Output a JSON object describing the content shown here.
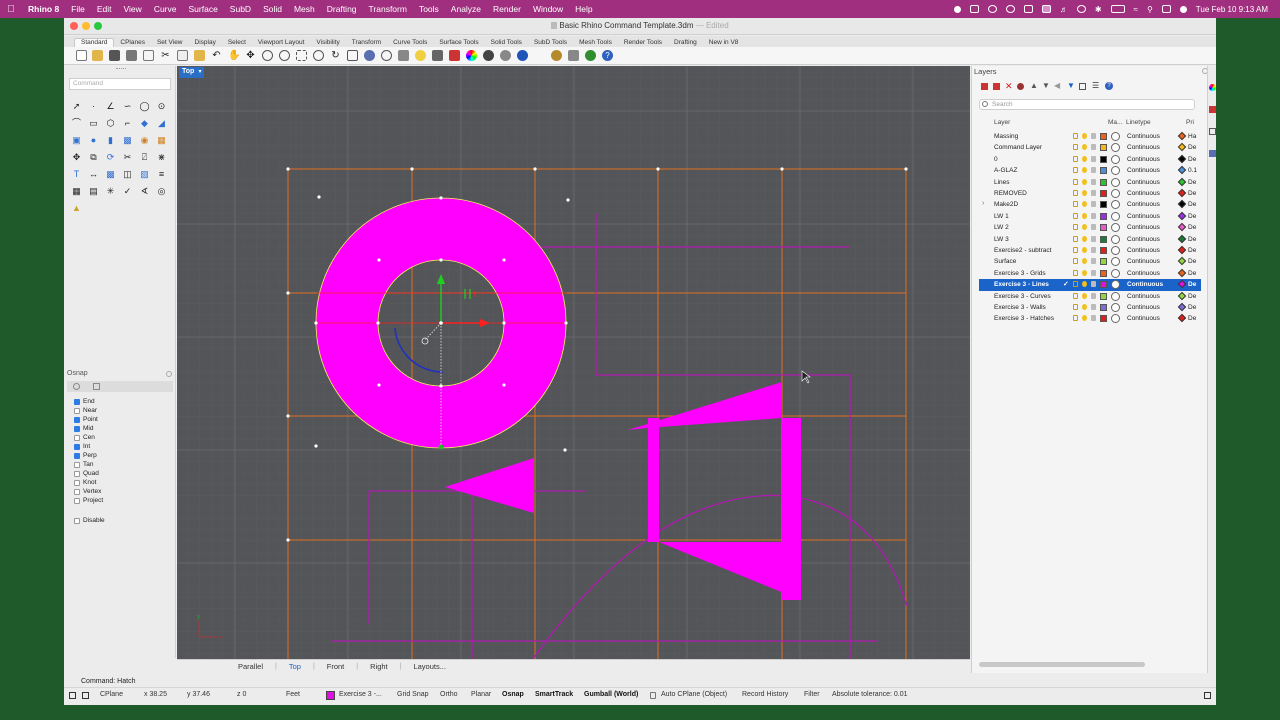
{
  "menubar": {
    "app_name": "Rhino 8",
    "items": [
      "File",
      "Edit",
      "View",
      "Curve",
      "Surface",
      "SubD",
      "Solid",
      "Mesh",
      "Drafting",
      "Transform",
      "Tools",
      "Analyze",
      "Render",
      "Window",
      "Help"
    ],
    "datetime": "Tue Feb 10  9:13 AM"
  },
  "window": {
    "title": "Basic Rhino Command Template.3dm",
    "title_suffix": "— Edited"
  },
  "toolbar_tabs": [
    "Standard",
    "CPlanes",
    "Set View",
    "Display",
    "Select",
    "Viewport Layout",
    "Visibility",
    "Transform",
    "Curve Tools",
    "Surface Tools",
    "Solid Tools",
    "SubD Tools",
    "Mesh Tools",
    "Render Tools",
    "Drafting",
    "New in V8"
  ],
  "command": {
    "placeholder": "Command",
    "history": "Command: Hatch"
  },
  "osnap": {
    "title": "Osnap",
    "items": [
      {
        "label": "End",
        "checked": true
      },
      {
        "label": "Near",
        "checked": false
      },
      {
        "label": "Point",
        "checked": true
      },
      {
        "label": "Mid",
        "checked": true
      },
      {
        "label": "Cen",
        "checked": false
      },
      {
        "label": "Int",
        "checked": true
      },
      {
        "label": "Perp",
        "checked": true
      },
      {
        "label": "Tan",
        "checked": false
      },
      {
        "label": "Quad",
        "checked": false
      },
      {
        "label": "Knot",
        "checked": false
      },
      {
        "label": "Vertex",
        "checked": false
      },
      {
        "label": "Project",
        "checked": false
      }
    ],
    "disable_label": "Disable"
  },
  "viewport": {
    "label": "Top",
    "tabs": [
      "Parallel",
      "Top",
      "Front",
      "Right",
      "Layouts..."
    ],
    "active_tab": "Top",
    "axis_x": "x",
    "axis_y": "y"
  },
  "layers": {
    "title": "Layers",
    "search_placeholder": "Search",
    "columns": {
      "layer": "Layer",
      "material": "Ma...",
      "linetype": "Linetype",
      "print": "Pri"
    },
    "rows": [
      {
        "name": "Massing",
        "color": "#e8641e",
        "linetype": "Continuous",
        "print": "Ha",
        "diamond": "#e8641e"
      },
      {
        "name": "Command Layer",
        "color": "#f2b81c",
        "linetype": "Continuous",
        "print": "De",
        "diamond": "#f2b81c"
      },
      {
        "name": "0",
        "color": "#000000",
        "linetype": "Continuous",
        "print": "De",
        "diamond": "#000000"
      },
      {
        "name": "A-GLAZ",
        "color": "#4f8fd6",
        "linetype": "Continuous",
        "print": "0.1",
        "diamond": "#4f8fd6"
      },
      {
        "name": "Lines",
        "color": "#2fc22f",
        "linetype": "Continuous",
        "print": "De",
        "diamond": "#2fc22f"
      },
      {
        "name": "REMOVED",
        "color": "#e0201a",
        "linetype": "Continuous",
        "print": "De",
        "diamond": "#e0201a"
      },
      {
        "name": "Make2D",
        "color": "#000000",
        "linetype": "Continuous",
        "print": "De",
        "diamond": "#000000"
      },
      {
        "name": "LW 1",
        "color": "#9b30e0",
        "linetype": "Continuous",
        "print": "De",
        "diamond": "#9b30e0"
      },
      {
        "name": "LW 2",
        "color": "#e55cc8",
        "linetype": "Continuous",
        "print": "De",
        "diamond": "#e55cc8"
      },
      {
        "name": "LW 3",
        "color": "#1f7a32",
        "linetype": "Continuous",
        "print": "De",
        "diamond": "#1f7a32"
      },
      {
        "name": "Exercise2 - subtract",
        "color": "#e0201a",
        "linetype": "Continuous",
        "print": "De",
        "diamond": "#e0201a"
      },
      {
        "name": "Surface",
        "color": "#8fd640",
        "linetype": "Continuous",
        "print": "De",
        "diamond": "#8fd640"
      },
      {
        "name": "Exercise 3 - Grids",
        "color": "#e8641e",
        "linetype": "Continuous",
        "print": "De",
        "diamond": "#e8641e"
      },
      {
        "name": "Exercise 3 - Lines",
        "color": "#e010e0",
        "linetype": "Continuous",
        "print": "De",
        "diamond": "#e010e0",
        "selected": true
      },
      {
        "name": "Exercise 3 - Curves",
        "color": "#8fd640",
        "linetype": "Continuous",
        "print": "De",
        "diamond": "#8fd640"
      },
      {
        "name": "Exercise 3 - Walls",
        "color": "#7a6fd6",
        "linetype": "Continuous",
        "print": "De",
        "diamond": "#7a6fd6"
      },
      {
        "name": "Exercise 3 - Hatches",
        "color": "#e0201a",
        "linetype": "Continuous",
        "print": "De",
        "diamond": "#e0201a"
      }
    ]
  },
  "status": {
    "cplane": "CPlane",
    "x": "x 38.25",
    "y": "y 37.46",
    "z": "z 0",
    "units": "Feet",
    "layer": "Exercise 3 -...",
    "layer_color": "#e010e0",
    "grid_snap": "Grid Snap",
    "ortho": "Ortho",
    "planar": "Planar",
    "osnap": "Osnap",
    "smarttrack": "SmartTrack",
    "gumball": "Gumball (World)",
    "auto_cplane": "Auto CPlane (Object)",
    "record_history": "Record History",
    "filter": "Filter",
    "tolerance": "Absolute tolerance: 0.01"
  },
  "colors": {
    "hatch": "#ff00ff",
    "grid_lines": "#e07020",
    "viewport_bg": "#545558",
    "selection_blue": "#1a63c9"
  }
}
